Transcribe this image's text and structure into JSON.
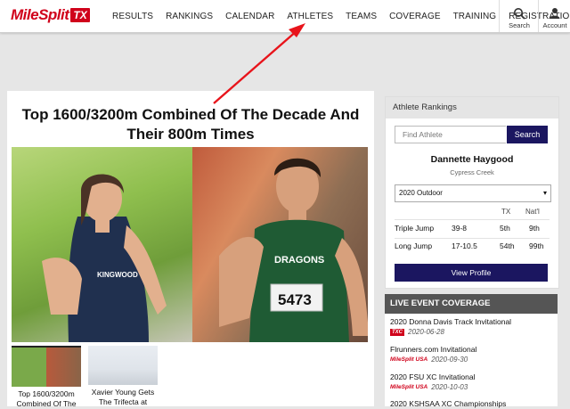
{
  "logo": {
    "word1": "Mile",
    "word2": "Split",
    "state": "TX"
  },
  "nav": [
    "RESULTS",
    "RANKINGS",
    "CALENDAR",
    "ATHLETES",
    "TEAMS",
    "COVERAGE",
    "TRAINING",
    "REGISTRATION"
  ],
  "search_label": "Search",
  "account_label": "Account",
  "article": {
    "title_line1": "Top 1600/3200m Combined Of The Decade And",
    "title_line2": "Their 800m Times",
    "bib_number": "5473",
    "jersey_left": "KINGWOOD",
    "jersey_right": "DRAGONS",
    "thumbs": [
      {
        "caption": "Top 1600/3200m Combined Of The"
      },
      {
        "caption": "Xavier Young Gets The Trifecta at"
      }
    ]
  },
  "rankings": {
    "header": "Athlete Rankings",
    "search_placeholder": "Find Athlete",
    "search_button": "Search",
    "athlete_name": "Dannette Haygood",
    "school": "Cypress Creek",
    "season": "2020 Outdoor",
    "col_tx": "TX",
    "col_natl": "Nat'l",
    "rows": [
      {
        "event": "Triple Jump",
        "mark": "39-8",
        "tx": "5th",
        "natl": "9th"
      },
      {
        "event": "Long Jump",
        "mark": "17-10.5",
        "tx": "54th",
        "natl": "99th"
      }
    ],
    "profile_button": "View Profile"
  },
  "live": {
    "header": "LIVE EVENT COVERAGE",
    "events": [
      {
        "name": "2020 Donna Davis Track Invitational",
        "badge": "TXC",
        "date": "2020-06-28"
      },
      {
        "name": "Flrunners.com Invitational",
        "badge": "MileSplit USA",
        "date": "2020-09-30"
      },
      {
        "name": "2020 FSU XC Invitational",
        "badge": "MileSplit USA",
        "date": "2020-10-03"
      },
      {
        "name": "2020 KSHSAA XC Championships",
        "badge": "",
        "date": ""
      }
    ]
  },
  "colors": {
    "brand_red": "#d0021b",
    "button_navy": "#1b1660",
    "annotation_arrow": "#e8141b"
  }
}
